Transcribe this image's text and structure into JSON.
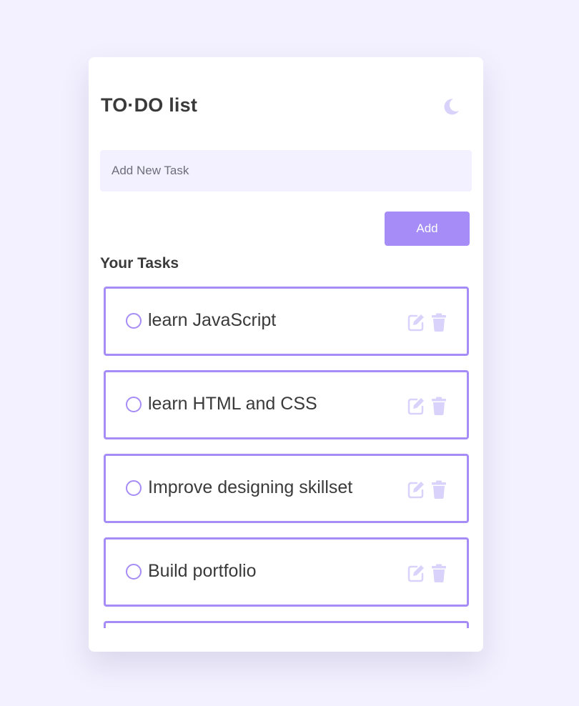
{
  "header": {
    "title": "TO·DO list",
    "theme_toggle_icon": "moon-icon"
  },
  "new_task": {
    "placeholder": "Add New Task",
    "value": "",
    "add_label": "Add"
  },
  "tasks_section": {
    "heading": "Your Tasks"
  },
  "tasks": [
    {
      "text": "learn JavaScript",
      "completed": false,
      "edit_icon": "edit-icon",
      "delete_icon": "trash-icon"
    },
    {
      "text": "learn HTML and CSS",
      "completed": false,
      "edit_icon": "edit-icon",
      "delete_icon": "trash-icon"
    },
    {
      "text": "Improve designing skillset",
      "completed": false,
      "edit_icon": "edit-icon",
      "delete_icon": "trash-icon"
    },
    {
      "text": "Build portfolio",
      "completed": false,
      "edit_icon": "edit-icon",
      "delete_icon": "trash-icon"
    },
    {
      "text": "",
      "completed": false,
      "edit_icon": "edit-icon",
      "delete_icon": "trash-icon"
    }
  ],
  "colors": {
    "page_background": "#f3f1ff",
    "accent": "#a58cf6",
    "icon_light": "#d9d2fb",
    "text": "#3a3a3a"
  }
}
